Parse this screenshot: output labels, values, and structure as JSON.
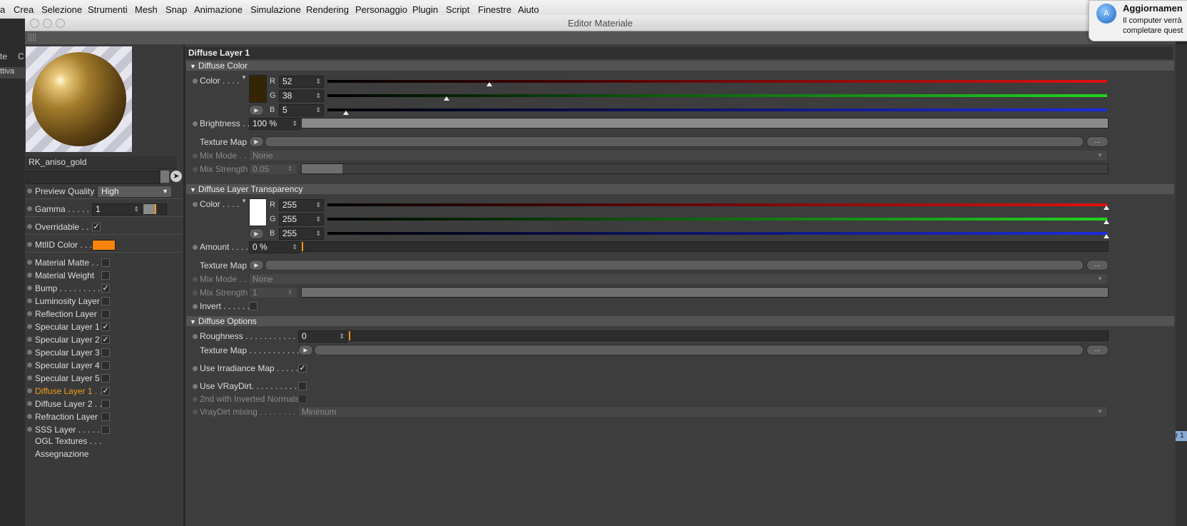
{
  "menubar": {
    "items": [
      "a",
      "Crea",
      "Selezione",
      "Strumenti",
      "Mesh",
      "Snap",
      "Animazione",
      "Simulazione",
      "Rendering",
      "Personaggio",
      "Plugin",
      "Script",
      "Finestre",
      "Aiuto"
    ]
  },
  "notification": {
    "title": "Aggiornamen",
    "line1": "Il computer verrà",
    "line2": "completare quest",
    "icon": "app-store-icon"
  },
  "background_app": {
    "text1": "te",
    "text2": "C",
    "text3": "ttiva",
    "chip": "r 1"
  },
  "window": {
    "title": "Editor Materiale"
  },
  "left": {
    "material_name": "RK_aniso_gold",
    "preview_quality_label": "Preview Quality",
    "preview_quality_value": "High",
    "gamma_label": "Gamma . . . . . .",
    "gamma_value": "1",
    "overridable_label": "Overridable . . .",
    "mtlid_label": "MtlID Color . . .",
    "mtlid_color": "#f7830c",
    "channels": [
      {
        "label": "Material Matte . .",
        "checked": false,
        "active": false
      },
      {
        "label": "Material Weight",
        "checked": false,
        "active": false
      },
      {
        "label": "Bump . . . . . . . . . .",
        "checked": true,
        "active": false
      },
      {
        "label": "Luminosity Layer",
        "checked": false,
        "active": false
      },
      {
        "label": "Reflection Layer",
        "checked": false,
        "active": false
      },
      {
        "label": "Specular Layer 1",
        "checked": true,
        "active": false
      },
      {
        "label": "Specular Layer 2",
        "checked": true,
        "active": false
      },
      {
        "label": "Specular Layer 3",
        "checked": false,
        "active": false
      },
      {
        "label": "Specular Layer 4",
        "checked": false,
        "active": false
      },
      {
        "label": "Specular Layer 5",
        "checked": false,
        "active": false
      },
      {
        "label": "Diffuse Layer 1 . .",
        "checked": true,
        "active": true
      },
      {
        "label": "Diffuse Layer 2 . .",
        "checked": false,
        "active": false
      },
      {
        "label": "Refraction Layer",
        "checked": false,
        "active": false
      },
      {
        "label": "SSS Layer . . . . . . .",
        "checked": false,
        "active": false
      }
    ],
    "ogl_label": "OGL Textures . . .",
    "assign_label": "Assegnazione"
  },
  "right": {
    "header": "Diffuse Layer 1",
    "diffuse_color": {
      "section": "Diffuse Color",
      "color_label": "Color . . . .",
      "swatch": "#342605",
      "r": "52",
      "g": "38",
      "b": "5",
      "r_level": 0.204,
      "g_level": 0.149,
      "b_level": 0.02,
      "brightness_label": "Brightness . .",
      "brightness": "100 %",
      "brightness_level": 1.0,
      "texture_label": "Texture Map",
      "mixmode_label": "Mix Mode . .",
      "mixmode": "None",
      "mixstrength_label": "Mix Strength",
      "mixstrength": "0.05",
      "mixstrength_level": 0.05
    },
    "transparency": {
      "section": "Diffuse Layer Transparency",
      "color_label": "Color . . . .",
      "swatch": "#ffffff",
      "r": "255",
      "g": "255",
      "b": "255",
      "amount_label": "Amount . . . .",
      "amount": "0 %",
      "amount_level": 0,
      "texture_label": "Texture Map",
      "mixmode_label": "Mix Mode . .",
      "mixmode": "None",
      "mixstrength_label": "Mix Strength",
      "mixstrength": "1",
      "mixstrength_level": 1,
      "invert_label": "Invert . . . . . ."
    },
    "options": {
      "section": "Diffuse Options",
      "roughness_label": "Roughness . . . . . . . . . . . . .",
      "roughness": "0",
      "texture_label": "Texture Map . . . . . . . . . . . .",
      "irradiance_label": "Use Irradiance Map . . . . . .",
      "vraydirt_label": "Use VRayDirt. . . . . . . . . . .",
      "inverted_label": "2nd with Inverted Normals",
      "mixing_label": "VrayDirt mixing . . . . . . . . .",
      "mixing_value": "Minimum"
    },
    "channel_letters": {
      "r": "R",
      "g": "G",
      "b": "B"
    },
    "ellipsis": "..."
  }
}
